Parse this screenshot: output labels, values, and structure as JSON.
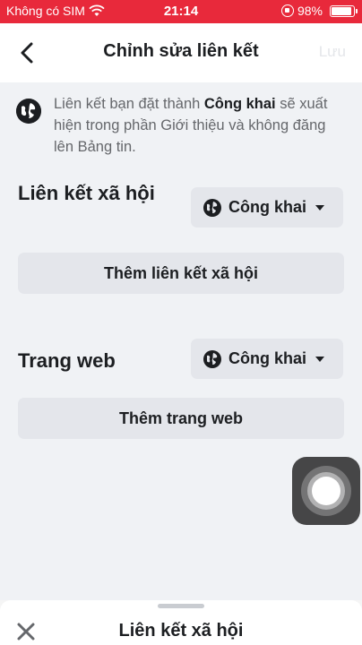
{
  "status_bar": {
    "carrier": "Không có SIM",
    "time": "21:14",
    "battery": "98%",
    "battery_level": 0.98
  },
  "header": {
    "title": "Chỉnh sửa liên kết",
    "save_label": "Lưu"
  },
  "info": {
    "text_before": "Liên kết bạn đặt thành ",
    "text_bold": "Công khai",
    "text_after": " sẽ xuất hiện trong phần Giới thiệu và không đăng lên Bảng tin."
  },
  "social_section": {
    "title": "Liên kết xã hội",
    "privacy_label": "Công khai",
    "add_button": "Thêm liên kết xã hội"
  },
  "website_section": {
    "title": "Trang web",
    "privacy_label": "Công khai",
    "add_button": "Thêm trang web"
  },
  "bottom_sheet": {
    "title": "Liên kết xã hội"
  },
  "icons": {
    "back": "chevron-left-icon",
    "globe": "globe-icon",
    "caret": "caret-down-icon",
    "close": "close-icon"
  }
}
